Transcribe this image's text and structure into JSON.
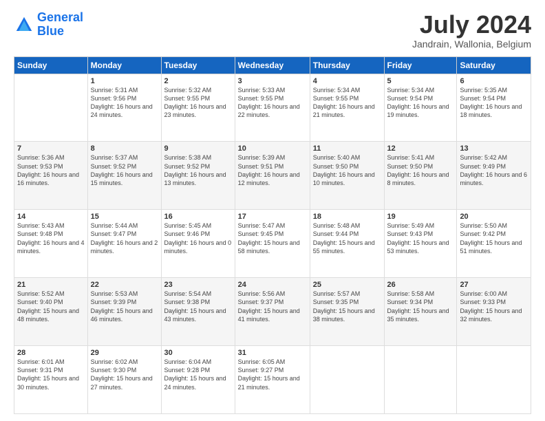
{
  "logo": {
    "line1": "General",
    "line2": "Blue"
  },
  "title": "July 2024",
  "subtitle": "Jandrain, Wallonia, Belgium",
  "weekdays": [
    "Sunday",
    "Monday",
    "Tuesday",
    "Wednesday",
    "Thursday",
    "Friday",
    "Saturday"
  ],
  "weeks": [
    [
      {
        "day": "",
        "sunrise": "",
        "sunset": "",
        "daylight": ""
      },
      {
        "day": "1",
        "sunrise": "Sunrise: 5:31 AM",
        "sunset": "Sunset: 9:56 PM",
        "daylight": "Daylight: 16 hours and 24 minutes."
      },
      {
        "day": "2",
        "sunrise": "Sunrise: 5:32 AM",
        "sunset": "Sunset: 9:55 PM",
        "daylight": "Daylight: 16 hours and 23 minutes."
      },
      {
        "day": "3",
        "sunrise": "Sunrise: 5:33 AM",
        "sunset": "Sunset: 9:55 PM",
        "daylight": "Daylight: 16 hours and 22 minutes."
      },
      {
        "day": "4",
        "sunrise": "Sunrise: 5:34 AM",
        "sunset": "Sunset: 9:55 PM",
        "daylight": "Daylight: 16 hours and 21 minutes."
      },
      {
        "day": "5",
        "sunrise": "Sunrise: 5:34 AM",
        "sunset": "Sunset: 9:54 PM",
        "daylight": "Daylight: 16 hours and 19 minutes."
      },
      {
        "day": "6",
        "sunrise": "Sunrise: 5:35 AM",
        "sunset": "Sunset: 9:54 PM",
        "daylight": "Daylight: 16 hours and 18 minutes."
      }
    ],
    [
      {
        "day": "7",
        "sunrise": "Sunrise: 5:36 AM",
        "sunset": "Sunset: 9:53 PM",
        "daylight": "Daylight: 16 hours and 16 minutes."
      },
      {
        "day": "8",
        "sunrise": "Sunrise: 5:37 AM",
        "sunset": "Sunset: 9:52 PM",
        "daylight": "Daylight: 16 hours and 15 minutes."
      },
      {
        "day": "9",
        "sunrise": "Sunrise: 5:38 AM",
        "sunset": "Sunset: 9:52 PM",
        "daylight": "Daylight: 16 hours and 13 minutes."
      },
      {
        "day": "10",
        "sunrise": "Sunrise: 5:39 AM",
        "sunset": "Sunset: 9:51 PM",
        "daylight": "Daylight: 16 hours and 12 minutes."
      },
      {
        "day": "11",
        "sunrise": "Sunrise: 5:40 AM",
        "sunset": "Sunset: 9:50 PM",
        "daylight": "Daylight: 16 hours and 10 minutes."
      },
      {
        "day": "12",
        "sunrise": "Sunrise: 5:41 AM",
        "sunset": "Sunset: 9:50 PM",
        "daylight": "Daylight: 16 hours and 8 minutes."
      },
      {
        "day": "13",
        "sunrise": "Sunrise: 5:42 AM",
        "sunset": "Sunset: 9:49 PM",
        "daylight": "Daylight: 16 hours and 6 minutes."
      }
    ],
    [
      {
        "day": "14",
        "sunrise": "Sunrise: 5:43 AM",
        "sunset": "Sunset: 9:48 PM",
        "daylight": "Daylight: 16 hours and 4 minutes."
      },
      {
        "day": "15",
        "sunrise": "Sunrise: 5:44 AM",
        "sunset": "Sunset: 9:47 PM",
        "daylight": "Daylight: 16 hours and 2 minutes."
      },
      {
        "day": "16",
        "sunrise": "Sunrise: 5:45 AM",
        "sunset": "Sunset: 9:46 PM",
        "daylight": "Daylight: 16 hours and 0 minutes."
      },
      {
        "day": "17",
        "sunrise": "Sunrise: 5:47 AM",
        "sunset": "Sunset: 9:45 PM",
        "daylight": "Daylight: 15 hours and 58 minutes."
      },
      {
        "day": "18",
        "sunrise": "Sunrise: 5:48 AM",
        "sunset": "Sunset: 9:44 PM",
        "daylight": "Daylight: 15 hours and 55 minutes."
      },
      {
        "day": "19",
        "sunrise": "Sunrise: 5:49 AM",
        "sunset": "Sunset: 9:43 PM",
        "daylight": "Daylight: 15 hours and 53 minutes."
      },
      {
        "day": "20",
        "sunrise": "Sunrise: 5:50 AM",
        "sunset": "Sunset: 9:42 PM",
        "daylight": "Daylight: 15 hours and 51 minutes."
      }
    ],
    [
      {
        "day": "21",
        "sunrise": "Sunrise: 5:52 AM",
        "sunset": "Sunset: 9:40 PM",
        "daylight": "Daylight: 15 hours and 48 minutes."
      },
      {
        "day": "22",
        "sunrise": "Sunrise: 5:53 AM",
        "sunset": "Sunset: 9:39 PM",
        "daylight": "Daylight: 15 hours and 46 minutes."
      },
      {
        "day": "23",
        "sunrise": "Sunrise: 5:54 AM",
        "sunset": "Sunset: 9:38 PM",
        "daylight": "Daylight: 15 hours and 43 minutes."
      },
      {
        "day": "24",
        "sunrise": "Sunrise: 5:56 AM",
        "sunset": "Sunset: 9:37 PM",
        "daylight": "Daylight: 15 hours and 41 minutes."
      },
      {
        "day": "25",
        "sunrise": "Sunrise: 5:57 AM",
        "sunset": "Sunset: 9:35 PM",
        "daylight": "Daylight: 15 hours and 38 minutes."
      },
      {
        "day": "26",
        "sunrise": "Sunrise: 5:58 AM",
        "sunset": "Sunset: 9:34 PM",
        "daylight": "Daylight: 15 hours and 35 minutes."
      },
      {
        "day": "27",
        "sunrise": "Sunrise: 6:00 AM",
        "sunset": "Sunset: 9:33 PM",
        "daylight": "Daylight: 15 hours and 32 minutes."
      }
    ],
    [
      {
        "day": "28",
        "sunrise": "Sunrise: 6:01 AM",
        "sunset": "Sunset: 9:31 PM",
        "daylight": "Daylight: 15 hours and 30 minutes."
      },
      {
        "day": "29",
        "sunrise": "Sunrise: 6:02 AM",
        "sunset": "Sunset: 9:30 PM",
        "daylight": "Daylight: 15 hours and 27 minutes."
      },
      {
        "day": "30",
        "sunrise": "Sunrise: 6:04 AM",
        "sunset": "Sunset: 9:28 PM",
        "daylight": "Daylight: 15 hours and 24 minutes."
      },
      {
        "day": "31",
        "sunrise": "Sunrise: 6:05 AM",
        "sunset": "Sunset: 9:27 PM",
        "daylight": "Daylight: 15 hours and 21 minutes."
      },
      {
        "day": "",
        "sunrise": "",
        "sunset": "",
        "daylight": ""
      },
      {
        "day": "",
        "sunrise": "",
        "sunset": "",
        "daylight": ""
      },
      {
        "day": "",
        "sunrise": "",
        "sunset": "",
        "daylight": ""
      }
    ]
  ]
}
